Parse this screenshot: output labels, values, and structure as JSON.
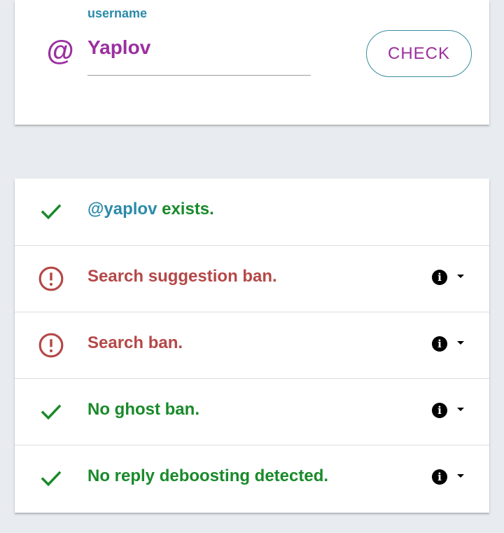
{
  "colors": {
    "accent_purple": "#9b2f9f",
    "accent_teal": "#2b8aa8",
    "button_border": "#3a8da0",
    "success_green": "#198a2a",
    "error_red": "#b54848"
  },
  "username_form": {
    "prefix_icon": "at-sign-icon",
    "prefix_glyph": "@",
    "label": "username",
    "value": "Yaplov",
    "check_label": "CHECK"
  },
  "results": [
    {
      "status": "ok",
      "icon": "checkmark-icon",
      "handle": "@yaplov",
      "text": " exists.",
      "has_info": false
    },
    {
      "status": "fail",
      "icon": "alert-circle-icon",
      "text": "Search suggestion ban.",
      "has_info": true
    },
    {
      "status": "fail",
      "icon": "alert-circle-icon",
      "text": "Search ban.",
      "has_info": true
    },
    {
      "status": "ok",
      "icon": "checkmark-icon",
      "text": "No ghost ban.",
      "has_info": true
    },
    {
      "status": "ok",
      "icon": "checkmark-icon",
      "text": "No reply deboosting detected.",
      "has_info": true
    }
  ]
}
